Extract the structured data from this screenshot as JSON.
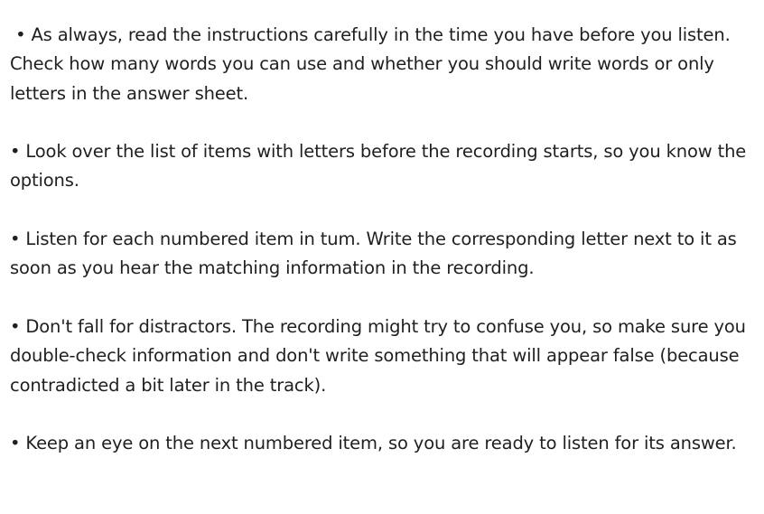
{
  "tips": [
    " • As always, read the instructions carefully in the time you have before you listen. Check how many words you can use and whether you should write words or only letters in the answer sheet.",
    "• Look over the list of items with letters before the recording starts, so you know the options.",
    "• Listen for each numbered item in tum. Write the corresponding letter next to it as soon as you hear the matching information in the recording.",
    "• Don't fall for distractors. The recording might try to confuse you, so make sure you double-check information and don't write something that will appear false (because contradicted a bit later in the track).",
    "• Keep an eye on the next numbered item, so you are ready to listen for its answer."
  ]
}
